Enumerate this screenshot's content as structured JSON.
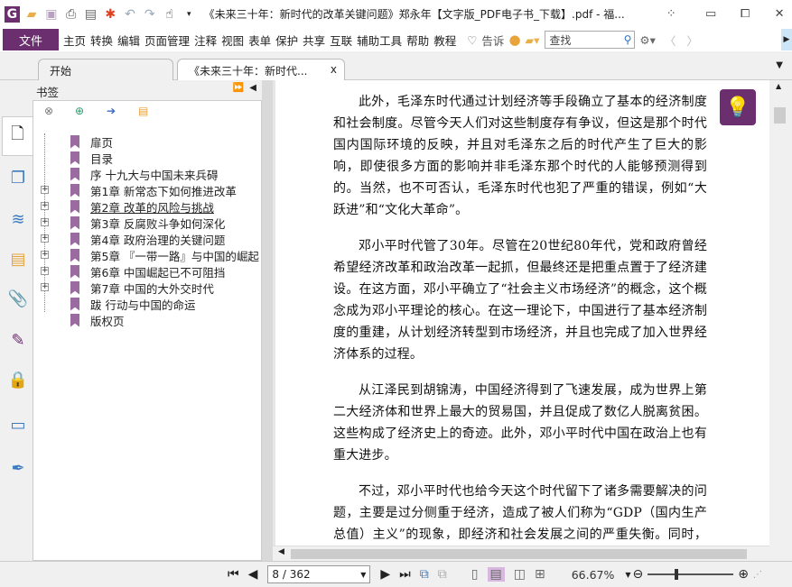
{
  "window": {
    "title": "《未来三十年：新时代的改革关键问题》郑永年【文字版_PDF电子书_下载】.pdf - 福...",
    "min": "▭",
    "max": "⧠",
    "close": "✕"
  },
  "ribbon": {
    "file": "文件",
    "menus": [
      "主页",
      "转换",
      "编辑",
      "页面管理",
      "注释",
      "视图",
      "表单",
      "保护",
      "共享",
      "互联",
      "辅助工具",
      "帮助",
      "教程"
    ],
    "tell": "告诉",
    "search_placeholder": "查找"
  },
  "tabs": [
    {
      "label": "开始"
    },
    {
      "label": "《未来三十年：新时代...",
      "close": "x"
    }
  ],
  "bookmarks": {
    "title": "书签",
    "items": [
      {
        "label": "扉页",
        "expandable": false
      },
      {
        "label": "目录",
        "expandable": false
      },
      {
        "label": "序 十九大与中国未来兵碍",
        "expandable": false
      },
      {
        "label": "第1章 新常态下如何推进改革",
        "expandable": true
      },
      {
        "label": "第2章 改革的风险与挑战",
        "expandable": true
      },
      {
        "label": "第3章 反腐败斗争如何深化",
        "expandable": true
      },
      {
        "label": "第4章 政府治理的关键问题",
        "expandable": true
      },
      {
        "label": "第5章 『一带一路』与中国的崛起",
        "expandable": true
      },
      {
        "label": "第6章 中国崛起已不可阻挡",
        "expandable": true
      },
      {
        "label": "第7章 中国的大外交时代",
        "expandable": true
      },
      {
        "label": "跋 行动与中国的命运",
        "expandable": false
      },
      {
        "label": "版权页",
        "expandable": false
      }
    ]
  },
  "document": {
    "paragraphs": [
      "此外，毛泽东时代通过计划经济等手段确立了基本的经济制度和社会制度。尽管今天人们对这些制度存有争议，但这是那个时代国内国际环境的反映，并且对毛泽东之后的时代产生了巨大的影响，即使很多方面的影响并非毛泽东那个时代的人能够预测得到的。当然，也不可否认，毛泽东时代也犯了严重的错误，例如“大跃进”和“文化大革命”。",
      "邓小平时代管了30年。尽管在20世纪80年代，党和政府曾经希望经济改革和政治改革一起抓，但最终还是把重点置于了经济建设。在这方面，邓小平确立了“社会主义市场经济”的概念，这个概念成为邓小平理论的核心。在这一理论下，中国进行了基本经济制度的重建，从计划经济转型到市场经济，并且也完成了加入世界经济体系的过程。",
      "从江泽民到胡锦涛，中国经济得到了飞速发展，成为世界上第二大经济体和世界上最大的贸易国，并且促成了数亿人脱离贫困。这些构成了经济史上的奇迹。此外，邓小平时代中国在政治上也有重大进步。",
      "不过，邓小平时代也给今天这个时代留下了诸多需要解决的问题，主要是过分侧重于经济，造成了被人们称为“GDP（国内生产总值）主义”的现象，即经济和社会发展之间的严重失衡。同时，经济高速发展所带来的巨大红利也掩盖了很多政治方面的问题，造成了严重的党政干部腐败和国家法治体系的薄弱等。"
    ]
  },
  "status": {
    "page": "8 / 362",
    "zoom": "66.67%"
  },
  "colors": {
    "accent": "#6b2e6e",
    "bookmark": "#9b6aa0"
  }
}
